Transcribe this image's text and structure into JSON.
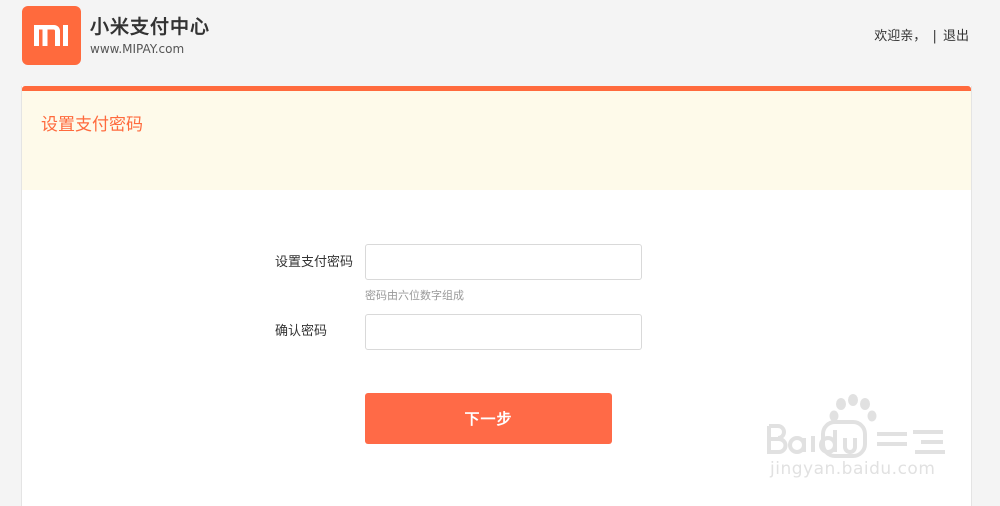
{
  "header": {
    "brand_title": "小米支付中心",
    "brand_url": "www.MIPAY.com",
    "welcome_text": "欢迎亲，",
    "separator": "|",
    "logout_label": "退出"
  },
  "card": {
    "title": "设置支付密码"
  },
  "form": {
    "password_label": "设置支付密码",
    "password_value": "",
    "password_hint": "密码由六位数字组成",
    "confirm_label": "确认密码",
    "confirm_value": "",
    "next_button_label": "下一步"
  },
  "watermark": {
    "text": "jingyan.baidu.com",
    "icon": "baidu-jingyan-logo-icon"
  },
  "colors": {
    "accent": "#ff6a3d",
    "header_band": "#fefaea",
    "button": "#ff6a47"
  }
}
